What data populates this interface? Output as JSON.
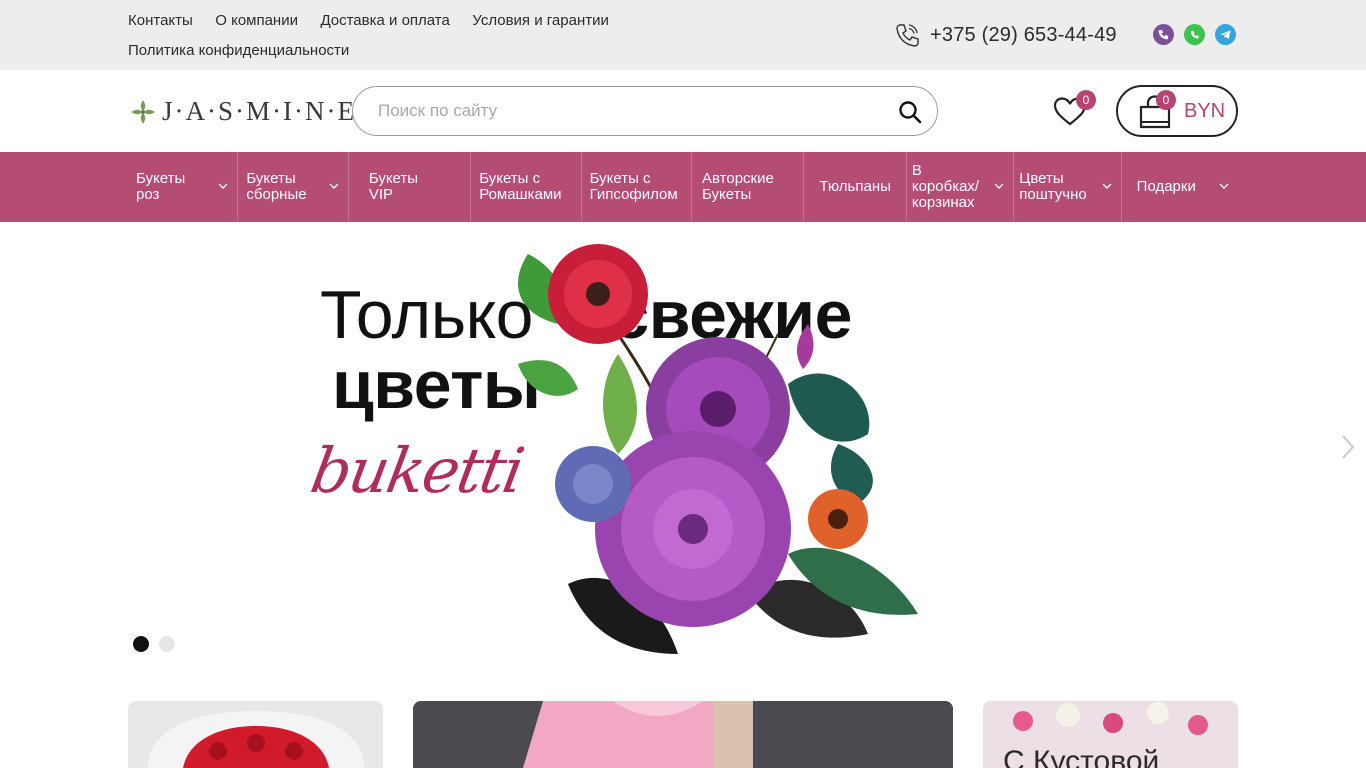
{
  "topbar": {
    "links": [
      "Контакты",
      "О компании",
      "Доставка и оплата",
      "Условия и гарантии",
      "Политика конфиденциальности"
    ],
    "phone": "+375 (29) 653-44-49",
    "messengers": [
      "viber-icon",
      "whatsapp-icon",
      "telegram-icon"
    ]
  },
  "header": {
    "logo_text": "J·A·S·M·I·N·E",
    "search_placeholder": "Поиск по сайту",
    "favorites_count": "0",
    "cart_count": "0",
    "currency": "BYN"
  },
  "nav": {
    "items": [
      {
        "label": "Букеты\nроз",
        "dropdown": true
      },
      {
        "label": "Букеты\nсборные",
        "dropdown": true
      },
      {
        "label": "Букеты\nVIP",
        "dropdown": false
      },
      {
        "label": "Букеты с\nРомашками",
        "dropdown": false
      },
      {
        "label": "Букеты с\nГипсофилом",
        "dropdown": false
      },
      {
        "label": "Авторские\nБукеты",
        "dropdown": false
      },
      {
        "label": "Тюльпаны",
        "dropdown": false
      },
      {
        "label": "В\nкоробках/\nкорзинах",
        "dropdown": true
      },
      {
        "label": "Цветы\nпоштучно",
        "dropdown": true
      },
      {
        "label": "Подарки",
        "dropdown": true
      }
    ]
  },
  "slider": {
    "title_line1_a": "Только",
    "title_line1_b": "свежие",
    "title_line2": "цветы",
    "script_text": "buketti",
    "dots_total": 2,
    "active_dot": 1
  },
  "promo_cards": [
    {
      "title": ""
    },
    {
      "title": ""
    },
    {
      "title": "С Кустовой"
    }
  ],
  "colors": {
    "accent": "#b44c74",
    "topbar_bg": "#ededed",
    "badge": "#b64574"
  }
}
